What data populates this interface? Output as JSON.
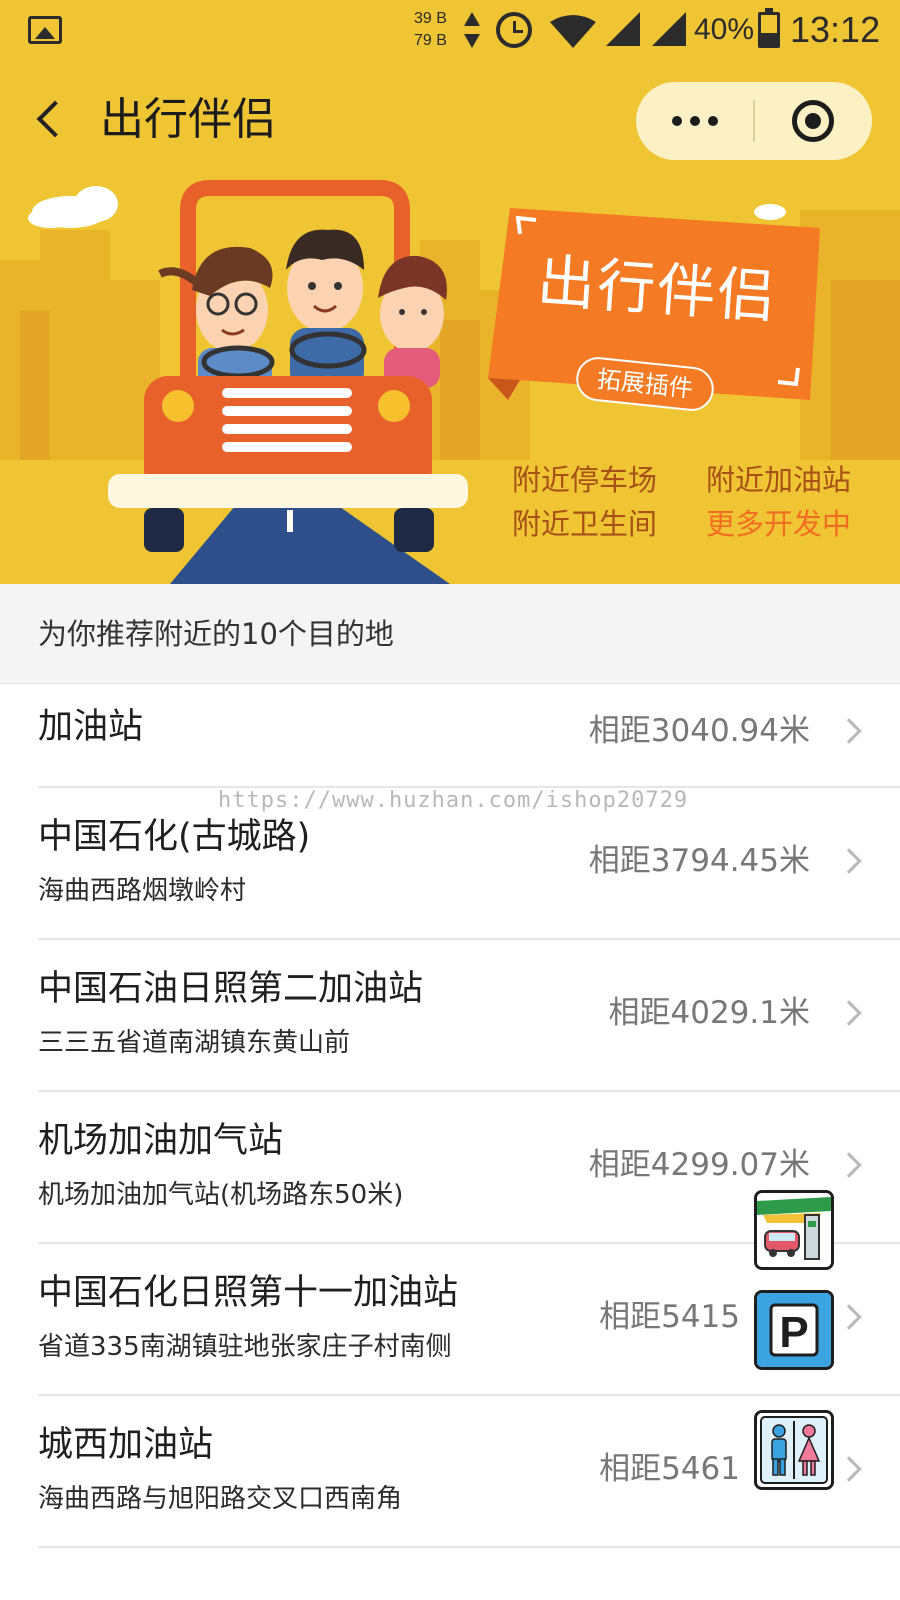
{
  "status_bar": {
    "net_up": "39 B",
    "net_down": "79 B",
    "battery": "40%",
    "battery_level": 0.4,
    "time": "13:12",
    "icons": [
      "image-icon",
      "network-arrows-icon",
      "alarm-icon",
      "wifi-icon",
      "signal-icon",
      "battery-icon"
    ]
  },
  "nav": {
    "title": "出行伴侣",
    "back_icon": "chevron-left-icon",
    "more_icon": "more-dots-icon",
    "close_icon": "target-close-icon"
  },
  "banner": {
    "tag_title": "出行伴侣",
    "tag_subtitle": "拓展插件",
    "features": [
      "附近停车场",
      "附近加油站",
      "附近卫生间",
      "更多开发中"
    ],
    "colors": {
      "background": "#f0c533",
      "tag": "#f47a24",
      "car": "#e9612a",
      "highlight": "#f26d21"
    }
  },
  "list": {
    "header": "为你推荐附近的10个目的地",
    "items": [
      {
        "name": "加油站",
        "address": "",
        "distance": "相距3040.94米"
      },
      {
        "name": "中国石化(古城路)",
        "address": "海曲西路烟墩岭村",
        "distance": "相距3794.45米"
      },
      {
        "name": "中国石油日照第二加油站",
        "address": "三三五省道南湖镇东黄山前",
        "distance": "相距4029.1米"
      },
      {
        "name": "机场加油加气站",
        "address": "机场加油加气站(机场路东50米)",
        "distance": "相距4299.07米"
      },
      {
        "name": "中国石化日照第十一加油站",
        "address": "省道335南湖镇驻地张家庄子村南侧",
        "distance": "相距5415"
      },
      {
        "name": "城西加油站",
        "address": "海曲西路与旭阳路交叉口西南角",
        "distance": "相距5461"
      }
    ]
  },
  "watermark": "https://www.huzhan.com/ishop20729",
  "floating_buttons": [
    {
      "icon": "gas-station-icon"
    },
    {
      "icon": "parking-icon",
      "letter": "P"
    },
    {
      "icon": "restroom-icon"
    }
  ]
}
